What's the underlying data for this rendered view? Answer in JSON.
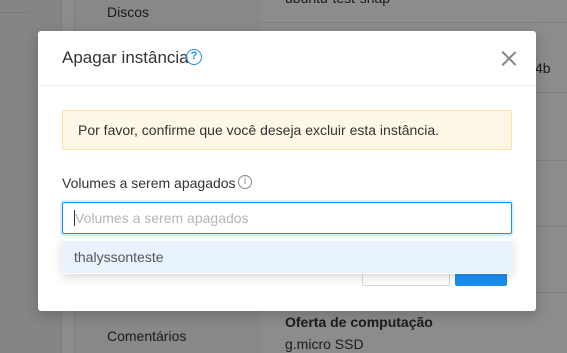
{
  "background": {
    "left_labels": [
      "Discos",
      "Comentários"
    ],
    "right_values": [
      "ubuntu-test-snap",
      "4b",
      "Oferta de computação",
      "g.micro SSD"
    ]
  },
  "dialog": {
    "title": "Apagar instância",
    "help_glyph": "?",
    "alert_text": "Por favor, confirme que você deseja excluir esta instância.",
    "volumes_label": "Volumes a serem apagados",
    "info_glyph": "i",
    "volumes_placeholder": "Volumes a serem apagados",
    "volumes_options": [
      "thalyssonteste"
    ]
  },
  "icons": {
    "help": "question-circle-icon",
    "info": "info-circle-icon",
    "close": "close-icon"
  },
  "colors": {
    "primary": "#1a8ef0",
    "alert_bg": "#fff8e6",
    "alert_border": "#fde2a4",
    "option_hover": "#e8f3fd"
  }
}
